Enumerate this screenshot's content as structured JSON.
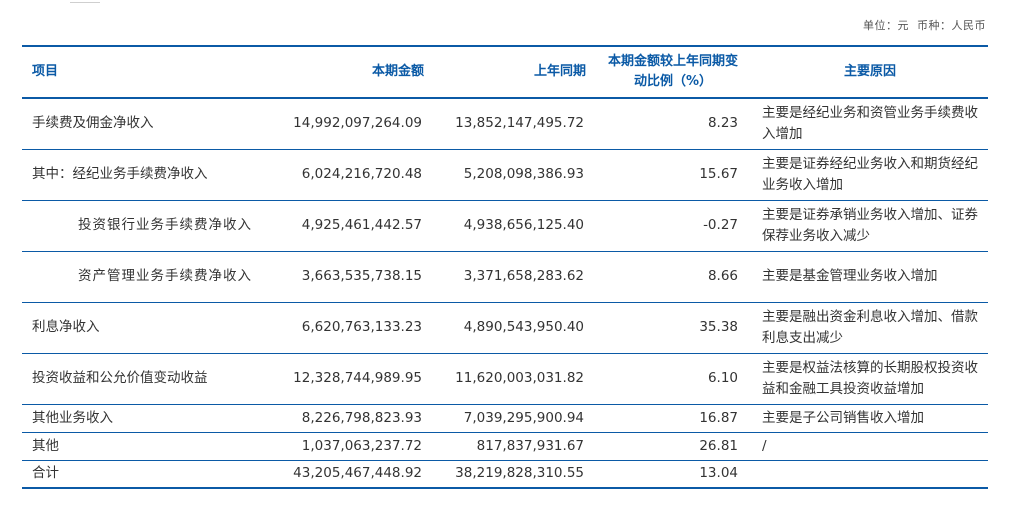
{
  "header": {
    "unit_label": "单位：元",
    "currency_label": "币种：人民币"
  },
  "table": {
    "columns": [
      "项目",
      "本期金额",
      "上年同期",
      "本期金额较上年同期变动比例（%）",
      "主要原因"
    ],
    "rows": [
      {
        "item": "手续费及佣金净收入",
        "current": "14,992,097,264.09",
        "prior": "13,852,147,495.72",
        "change": "8.23",
        "reason": "主要是经纪业务和资管业务手续费收入增加"
      },
      {
        "item": "其中：经纪业务手续费净收入",
        "current": "6,024,216,720.48",
        "prior": "5,208,098,386.93",
        "change": "15.67",
        "reason": "主要是证券经纪业务收入和期货经纪业务收入增加"
      },
      {
        "item": "投资银行业务手续费净收入",
        "current": "4,925,461,442.57",
        "prior": "4,938,656,125.40",
        "change": "-0.27",
        "reason": "主要是证券承销业务收入增加、证券保荐业务收入减少"
      },
      {
        "item": "资产管理业务手续费净收入",
        "current": "3,663,535,738.15",
        "prior": "3,371,658,283.62",
        "change": "8.66",
        "reason": "主要是基金管理业务收入增加"
      },
      {
        "item": "利息净收入",
        "current": "6,620,763,133.23",
        "prior": "4,890,543,950.40",
        "change": "35.38",
        "reason": "主要是融出资金利息收入增加、借款利息支出减少"
      },
      {
        "item": "投资收益和公允价值变动收益",
        "current": "12,328,744,989.95",
        "prior": "11,620,003,031.82",
        "change": "6.10",
        "reason": "主要是权益法核算的长期股权投资收益和金融工具投资收益增加"
      },
      {
        "item": "其他业务收入",
        "current": "8,226,798,823.93",
        "prior": "7,039,295,900.94",
        "change": "16.87",
        "reason": "主要是子公司销售收入增加"
      },
      {
        "item": "其他",
        "current": "1,037,063,237.72",
        "prior": "817,837,931.67",
        "change": "26.81",
        "reason": "/"
      },
      {
        "item": "合计",
        "current": "43,205,467,448.92",
        "prior": "38,219,828,310.55",
        "change": "13.04",
        "reason": ""
      }
    ]
  }
}
